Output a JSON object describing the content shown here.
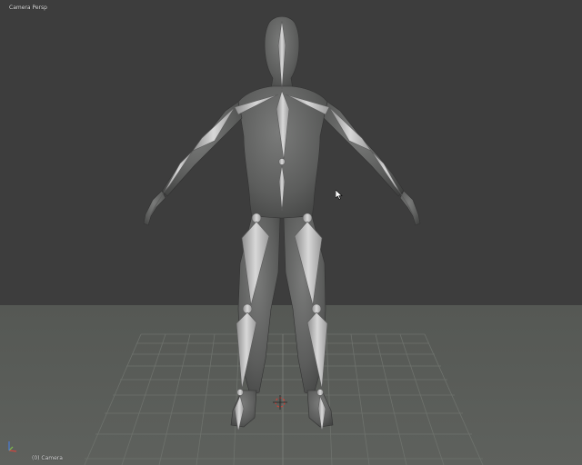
{
  "viewport": {
    "view_name": "Camera Persp",
    "object_label": "(0) Camera"
  },
  "colors": {
    "background": "#3d3d3d",
    "floor": "#5a5d59",
    "grid": "#6c706b",
    "mesh": "#5f605f",
    "bone": "#bcbcbc",
    "cursor_red": "#c8443a",
    "axis_x": "#d0453f",
    "axis_y": "#7dc24d",
    "axis_z": "#4a7bd6"
  },
  "icons": {
    "axis_gizmo": "xyz-axis-gizmo-icon",
    "view_3d_cursor": "3d-cursor-icon",
    "mouse_pointer": "arrow-pointer-icon"
  }
}
